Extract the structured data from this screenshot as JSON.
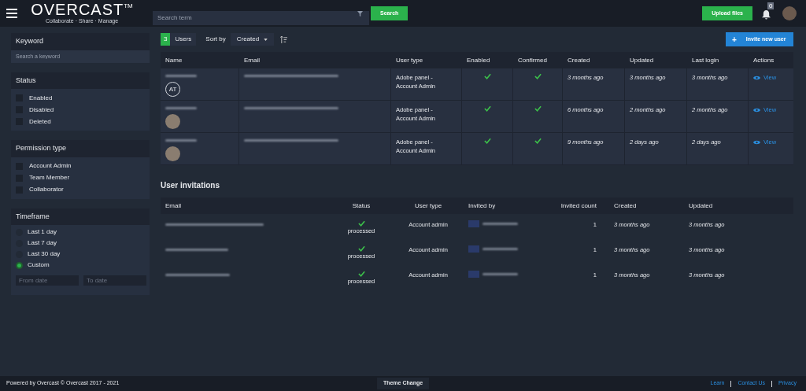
{
  "header": {
    "logo": "OVERCAST",
    "trademark": "TM",
    "tagline": "Collaborate · Share · Manage",
    "search_placeholder": "Search term",
    "search_button": "Search",
    "upload_button": "Upload files",
    "notification_count": "0"
  },
  "filters": {
    "keyword": {
      "title": "Keyword",
      "placeholder": "Search a keyword"
    },
    "status": {
      "title": "Status",
      "options": [
        {
          "label": "Enabled",
          "checked": false
        },
        {
          "label": "Disabled",
          "checked": false
        },
        {
          "label": "Deleted",
          "checked": false
        }
      ]
    },
    "permission": {
      "title": "Permission type",
      "options": [
        {
          "label": "Account Admin",
          "checked": false
        },
        {
          "label": "Team Member",
          "checked": false
        },
        {
          "label": "Collaborator",
          "checked": false
        }
      ]
    },
    "timeframe": {
      "title": "Timeframe",
      "options": [
        {
          "label": "Last 1 day",
          "selected": false
        },
        {
          "label": "Last 7 day",
          "selected": false
        },
        {
          "label": "Last 30 day",
          "selected": false
        },
        {
          "label": "Custom",
          "selected": true
        }
      ],
      "from_placeholder": "From date",
      "to_placeholder": "To date"
    }
  },
  "users": {
    "count": "3",
    "label": "Users",
    "sort_label": "Sort by",
    "sort_value": "Created",
    "invite_plus": "+",
    "invite_button": "Invite new user",
    "columns": [
      "Name",
      "Email",
      "User type",
      "Enabled",
      "Confirmed",
      "Created",
      "Updated",
      "Last login",
      "Actions"
    ],
    "rows": [
      {
        "avatar": {
          "kind": "initials",
          "text": "AT"
        },
        "user_type": "Adobe panel - Account Admin",
        "enabled": true,
        "confirmed": true,
        "created": "3 months ago",
        "updated": "3 months ago",
        "last_login": "3 months ago",
        "action": "View"
      },
      {
        "avatar": {
          "kind": "photo"
        },
        "user_type": "Adobe panel - Account Admin",
        "enabled": true,
        "confirmed": true,
        "created": "6 months ago",
        "updated": "2 months ago",
        "last_login": "2 months ago",
        "action": "View"
      },
      {
        "avatar": {
          "kind": "photo"
        },
        "user_type": "Adobe panel - Account Admin",
        "enabled": true,
        "confirmed": true,
        "created": "9 months ago",
        "updated": "2 days ago",
        "last_login": "2 days ago",
        "action": "View"
      }
    ]
  },
  "invitations": {
    "title": "User invitations",
    "columns": [
      "Email",
      "Status",
      "User type",
      "Invited by",
      "Invited count",
      "Created",
      "Updated"
    ],
    "rows": [
      {
        "processed": true,
        "status": "processed",
        "user_type": "Account admin",
        "invited_count": "1",
        "created": "3 months ago",
        "updated": "3 months ago"
      },
      {
        "processed": true,
        "status": "processed",
        "user_type": "Account admin",
        "invited_count": "1",
        "created": "3 months ago",
        "updated": "3 months ago"
      },
      {
        "processed": true,
        "status": "processed",
        "user_type": "Account admin",
        "invited_count": "1",
        "created": "3 months ago",
        "updated": "3 months ago"
      }
    ]
  },
  "footer": {
    "powered": "Powered by Overcast © Overcast 2017 - 2021",
    "theme": "Theme Change",
    "links": [
      "Learn",
      "Contact Us",
      "Privacy"
    ]
  }
}
